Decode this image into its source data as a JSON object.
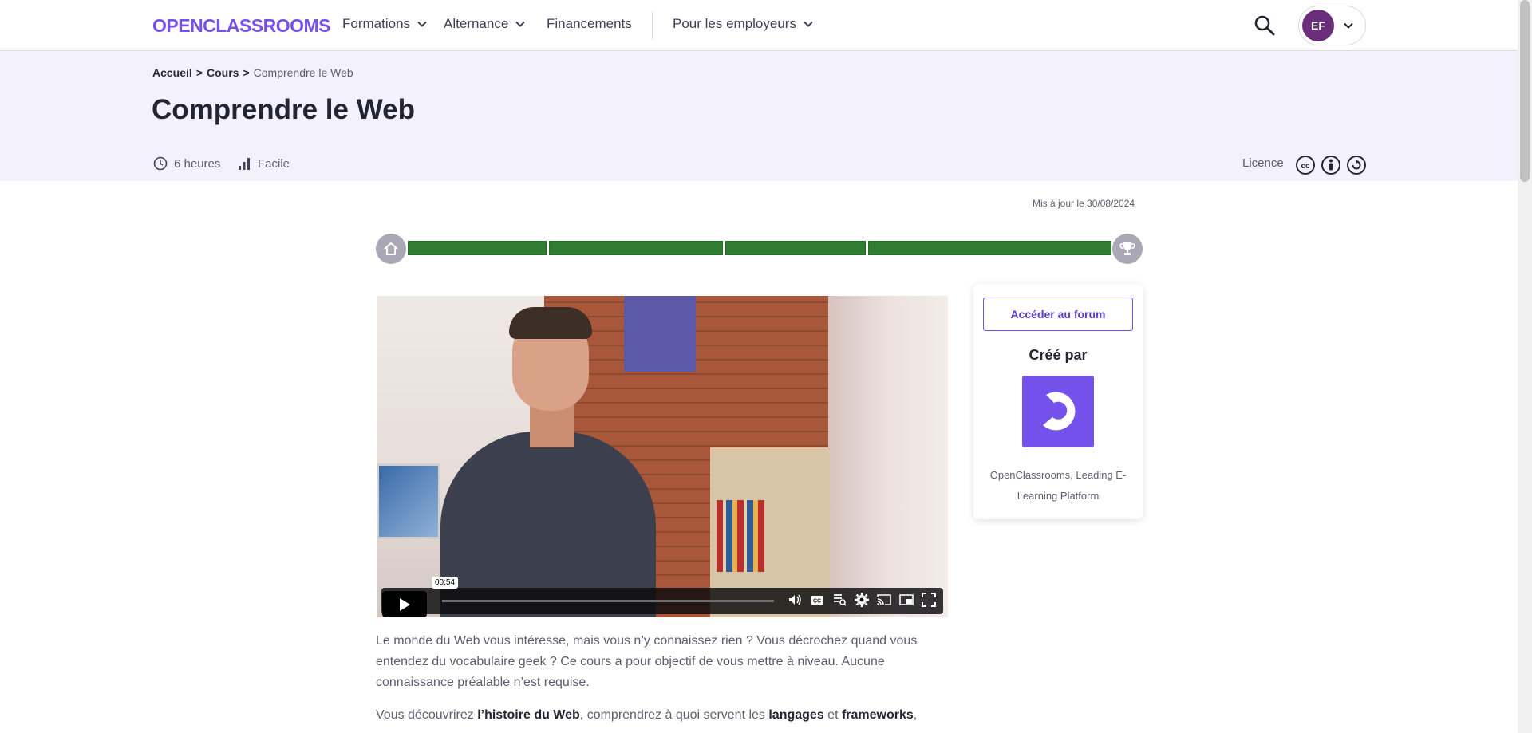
{
  "nav": {
    "logo": "OPENCLASSROOMS",
    "items": [
      "Formations",
      "Alternance",
      "Financements",
      "Pour les employeurs"
    ],
    "user_initials": "EF"
  },
  "breadcrumb": {
    "home": "Accueil",
    "sep1": ">",
    "courses": "Cours",
    "sep2": ">",
    "current": "Comprendre le Web"
  },
  "course": {
    "title": "Comprendre le Web",
    "duration": "6 heures",
    "level": "Facile",
    "licence_label": "Licence",
    "updated": "Mis à jour le 30/08/2024"
  },
  "progress": {
    "segments": 4,
    "completed": 4
  },
  "video": {
    "timestamp": "00:54"
  },
  "sidebar": {
    "forum_button": "Accéder au forum",
    "created_by": "Créé par",
    "author": "OpenClassrooms, Leading E-Learning Platform"
  },
  "description": {
    "p1": "Le monde du Web vous intéresse, mais vous n’y connaissez rien ? Vous décrochez quand vous entendez du vocabulaire geek ? Ce cours a pour objectif de vous mettre à niveau. Aucune connaissance préalable n’est requise.",
    "p2_a": "Vous découvrirez ",
    "p2_b": "l’histoire du Web",
    "p2_c": ", comprendrez à quoi servent les ",
    "p2_d": "langages",
    "p2_e": " et ",
    "p2_f": "frameworks",
    "p2_g": ","
  },
  "colors": {
    "brand": "#7451eb",
    "progress": "#2e7d32",
    "band": "#f3f2fc",
    "avatar": "#6b2e7b"
  }
}
